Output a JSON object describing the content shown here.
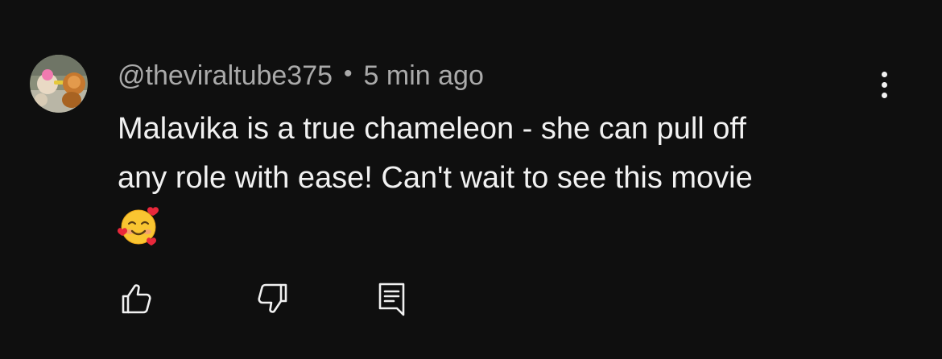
{
  "comment": {
    "author": "@theviraltube375",
    "separator": "•",
    "timestamp": "5 min ago",
    "text_lines": [
      "Malavika is a true chameleon - she can pull off",
      "any role with ease! Can't wait to see this movie"
    ],
    "emoji": "smiling-face-with-hearts",
    "avatar_icon": "avatar-photo"
  },
  "actions": {
    "like_icon": "thumbs-up-icon",
    "dislike_icon": "thumbs-down-icon",
    "reply_icon": "reply-comment-icon"
  },
  "menu_icon": "more-vert-icon",
  "colors": {
    "background": "#0f0f0f",
    "text_primary": "#f1f1f1",
    "text_secondary": "#aaaaaa"
  }
}
